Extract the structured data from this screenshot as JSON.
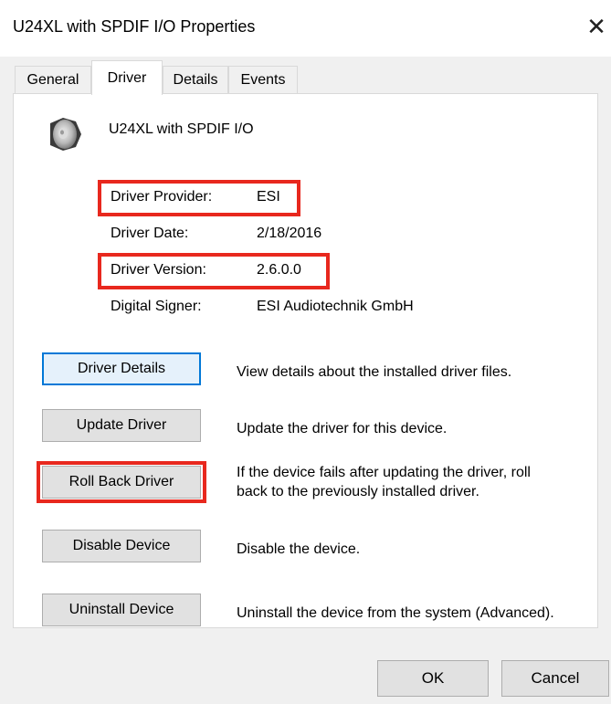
{
  "window": {
    "title": "U24XL with SPDIF I/O Properties",
    "close_glyph": "✕"
  },
  "tabs": [
    {
      "label": "General"
    },
    {
      "label": "Driver",
      "active": true
    },
    {
      "label": "Details"
    },
    {
      "label": "Events"
    }
  ],
  "device": {
    "name": "U24XL with SPDIF I/O",
    "icon": "speaker-icon"
  },
  "properties": [
    {
      "label": "Driver Provider:",
      "value": "ESI",
      "highlighted": true
    },
    {
      "label": "Driver Date:",
      "value": "2/18/2016",
      "highlighted": false
    },
    {
      "label": "Driver Version:",
      "value": "2.6.0.0",
      "highlighted": true
    },
    {
      "label": "Digital Signer:",
      "value": "ESI Audiotechnik GmbH",
      "highlighted": false
    }
  ],
  "actions": [
    {
      "label": "Driver Details",
      "description": "View details about the installed driver files."
    },
    {
      "label": "Update Driver",
      "description": "Update the driver for this device."
    },
    {
      "label": "Roll Back Driver",
      "description_line1": "If the device fails after updating the driver, roll",
      "description_line2": "back to the previously installed driver.",
      "highlighted": true
    },
    {
      "label": "Disable Device",
      "description": "Disable the device."
    },
    {
      "label": "Uninstall Device",
      "description": "Uninstall the device from the system (Advanced)."
    }
  ],
  "footer": {
    "ok_label": "OK",
    "cancel_label": "Cancel"
  },
  "colors": {
    "highlight": "#e8281e",
    "focus": "#0078d7"
  }
}
